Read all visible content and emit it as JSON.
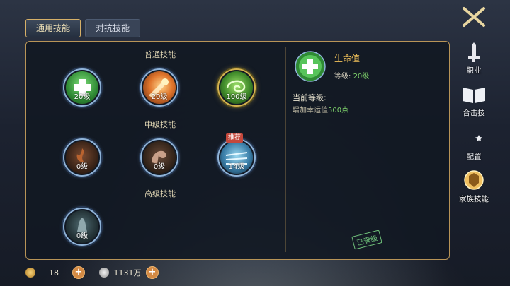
{
  "tabs": [
    {
      "label": "通用技能",
      "active": true
    },
    {
      "label": "对抗技能",
      "active": false
    }
  ],
  "sections": {
    "basic": "普通技能",
    "mid": "中级技能",
    "advanced": "高级技能"
  },
  "skills": [
    {
      "level": "20级",
      "icon": "plus-heal-icon"
    },
    {
      "level": "20级",
      "icon": "fire-strike-icon"
    },
    {
      "level": "100级",
      "icon": "wind-swirl-icon"
    },
    {
      "level": "0级",
      "icon": "flame-claw-icon"
    },
    {
      "level": "0级",
      "icon": "muscle-arm-icon"
    },
    {
      "level": "14级",
      "icon": "ice-slash-icon",
      "badge": "推荐"
    },
    {
      "level": "0级",
      "icon": "bell-totem-icon"
    }
  ],
  "detail": {
    "name": "生命值",
    "level_label": "等级:",
    "level_value": "20级",
    "current_title": "当前等级:",
    "current_desc_prefix": "增加幸运值",
    "current_desc_value": "500点",
    "maxed": "已满级"
  },
  "side_menu": [
    {
      "label": "职业",
      "icon": "sword-icon"
    },
    {
      "label": "合击技",
      "icon": "book-icon"
    },
    {
      "label": "配置",
      "icon": "moon-star-icon"
    },
    {
      "label": "家族技能",
      "icon": "family-emblem-icon",
      "active": true
    }
  ],
  "currency": {
    "item1": "18",
    "item2": "1131万"
  },
  "colors": {
    "accent_gold": "#b89457",
    "level_green": "#7ccf6a",
    "title_gold": "#f0c15a"
  }
}
